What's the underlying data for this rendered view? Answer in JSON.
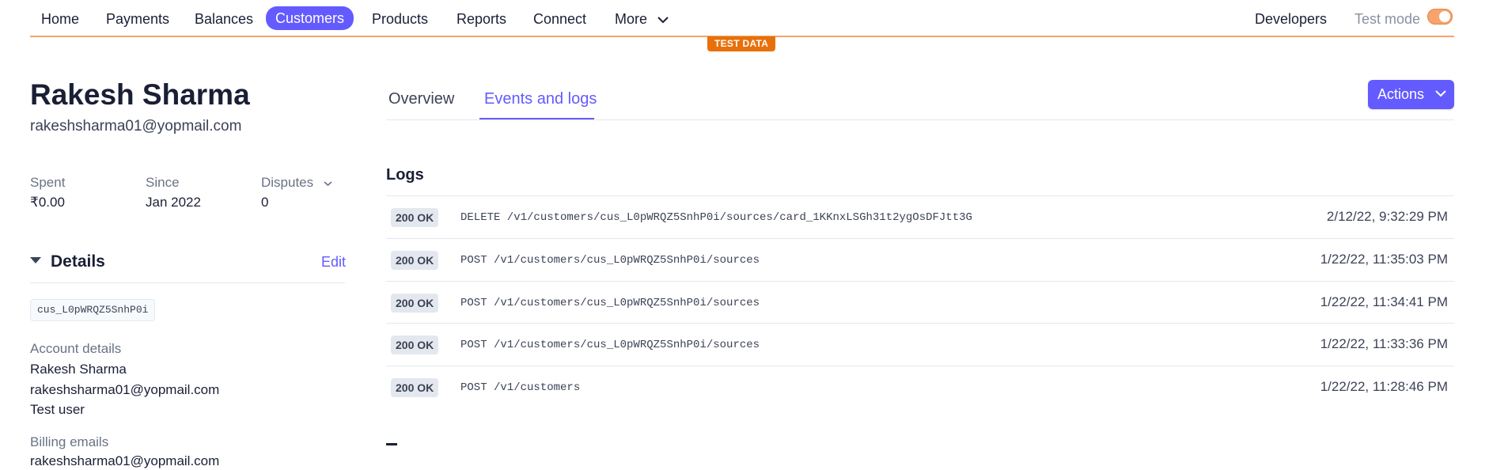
{
  "nav": {
    "items": [
      "Home",
      "Payments",
      "Balances",
      "Customers",
      "Products",
      "Reports",
      "Connect",
      "More"
    ],
    "developers": "Developers",
    "test_mode": "Test mode",
    "test_mode_on": true
  },
  "banner": {
    "test_data": "TEST DATA"
  },
  "colors": {
    "accent": "#635bff",
    "test": "#e8700a"
  },
  "customer": {
    "name": "Rakesh Sharma",
    "email": "rakeshsharma01@yopmail.com",
    "stats": [
      {
        "label": "Spent",
        "value": "₹0.00"
      },
      {
        "label": "Since",
        "value": "Jan 2022"
      },
      {
        "label": "Disputes",
        "value": "0"
      }
    ]
  },
  "details": {
    "title": "Details",
    "edit": "Edit",
    "id": "cus_L0pWRQZ5SnhP0i",
    "account_label": "Account details",
    "account_lines": [
      "Rakesh Sharma",
      "rakeshsharma01@yopmail.com",
      "Test user"
    ],
    "billing_label": "Billing emails",
    "billing_value": "rakeshsharma01@yopmail.com"
  },
  "tabs": [
    {
      "label": "Overview",
      "active": false
    },
    {
      "label": "Events and logs",
      "active": true
    }
  ],
  "actions_label": "Actions",
  "logs": {
    "title": "Logs",
    "rows": [
      {
        "status": "200 OK",
        "path": "DELETE /v1/customers/cus_L0pWRQZ5SnhP0i/sources/card_1KKnxLSGh31t2ygOsDFJtt3G",
        "time": "2/12/22, 9:32:29 PM"
      },
      {
        "status": "200 OK",
        "path": "POST /v1/customers/cus_L0pWRQZ5SnhP0i/sources",
        "time": "1/22/22, 11:35:03 PM"
      },
      {
        "status": "200 OK",
        "path": "POST /v1/customers/cus_L0pWRQZ5SnhP0i/sources",
        "time": "1/22/22, 11:34:41 PM"
      },
      {
        "status": "200 OK",
        "path": "POST /v1/customers/cus_L0pWRQZ5SnhP0i/sources",
        "time": "1/22/22, 11:33:36 PM"
      },
      {
        "status": "200 OK",
        "path": "POST /v1/customers",
        "time": "1/22/22, 11:28:46 PM"
      }
    ]
  }
}
